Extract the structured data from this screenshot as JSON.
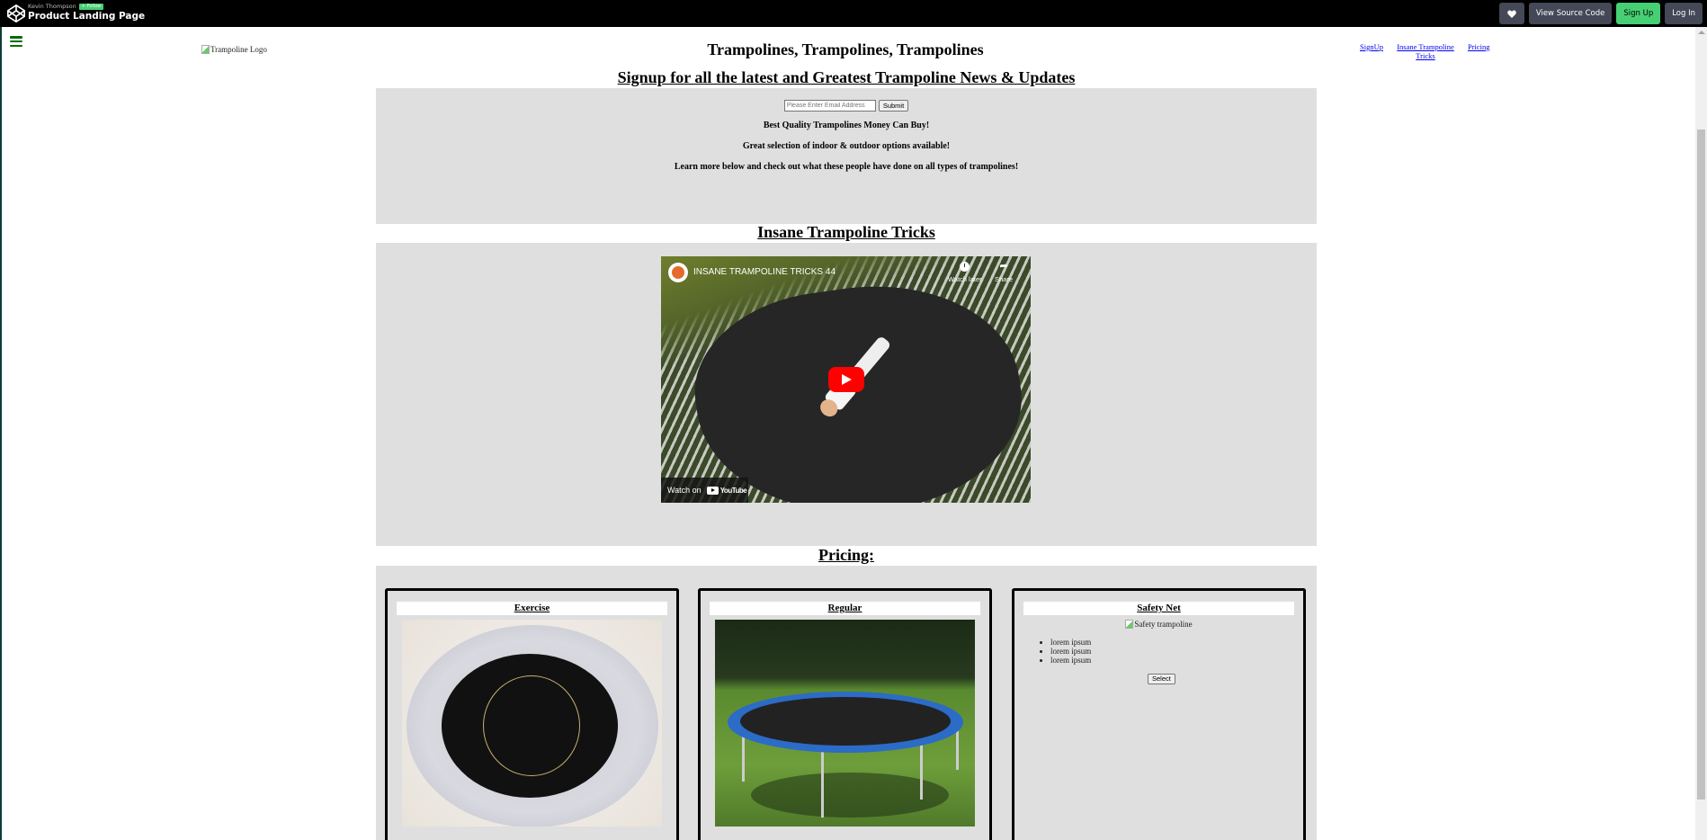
{
  "codepen": {
    "author": "Kevin Thompson",
    "follow_label": "Follow",
    "pen_title": "Product Landing Page",
    "actions": {
      "heart_icon": "heart-icon",
      "view_source_label": "View Source Code",
      "sign_up_label": "Sign Up",
      "log_in_label": "Log In"
    },
    "colors": {
      "bar": "#000000",
      "button": "#444857",
      "accent": "#47cf73"
    }
  },
  "header": {
    "menu_icon": "hamburger-icon",
    "logo_alt": "Trampoline Logo",
    "title": "Trampolines, Trampolines, Trampolines",
    "nav": [
      {
        "label": "SignUp"
      },
      {
        "label": "Insane Trampoline Tricks"
      },
      {
        "label": "Pricing"
      }
    ]
  },
  "signup": {
    "heading": "Signup for all the latest and Greatest Trampoline News & Updates",
    "email_placeholder": "Please Enter Email Address",
    "email_value": "",
    "submit_label": "Submit",
    "taglines": [
      "Best Quality Trampolines Money Can Buy!",
      "Great selection of indoor & outdoor options available!",
      "Learn more below and check out what these people have done on all types of trampolines!"
    ]
  },
  "tricks": {
    "heading": "Insane Trampoline Tricks",
    "video": {
      "title": "INSANE TRAMPOLINE TRICKS 44",
      "watch_later_label": "Watch later",
      "share_label": "Share",
      "watch_on_label": "Watch on",
      "platform": "YouTube"
    }
  },
  "pricing": {
    "heading": "Pricing:",
    "cards": [
      {
        "title": "Exercise",
        "image": "exercise-trampoline"
      },
      {
        "title": "Regular",
        "image": "regular-trampoline"
      },
      {
        "title": "Safety Net",
        "image_alt": "Safety trampoline",
        "items": [
          "lorem ipsum",
          "lorem ipsum",
          "lorem ipsum"
        ],
        "select_label": "Select"
      }
    ]
  }
}
